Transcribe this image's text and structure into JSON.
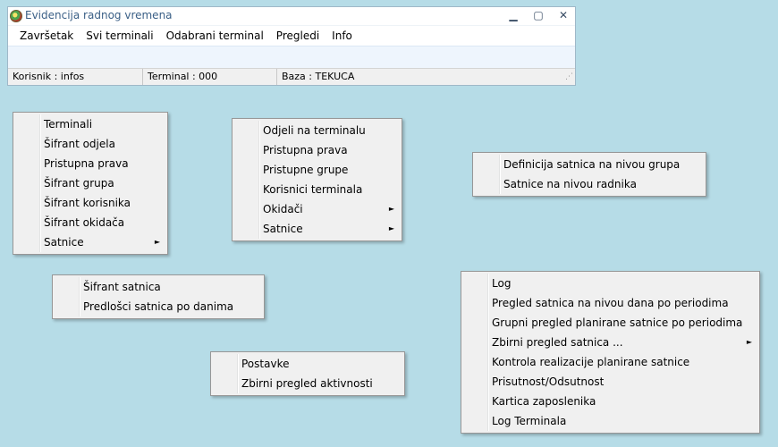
{
  "window": {
    "title": "Evidencija radnog vremena",
    "controls": {
      "minimize": "▁",
      "maximize": "▢",
      "close": "✕"
    },
    "menu": [
      "Završetak",
      "Svi terminali",
      "Odabrani terminal",
      "Pregledi",
      "Info"
    ],
    "status": {
      "user": "Korisnik : infos",
      "terminal": "Terminal : 000",
      "base": "Baza : TEKUCA"
    }
  },
  "menus": {
    "svi_terminali": {
      "items": [
        {
          "label": "Terminali"
        },
        {
          "label": "Šifrant odjela"
        },
        {
          "label": "Pristupna prava"
        },
        {
          "label": "Šifrant grupa"
        },
        {
          "label": "Šifrant korisnika"
        },
        {
          "label": "Šifrant okidača"
        },
        {
          "label": "Satnice",
          "arrow": "►"
        }
      ]
    },
    "odabrani_terminal": {
      "items": [
        {
          "label": "Odjeli na terminalu"
        },
        {
          "label": "Pristupna prava"
        },
        {
          "label": "Pristupne grupe"
        },
        {
          "label": "Korisnici terminala"
        },
        {
          "label": "Okidači",
          "arrow": "►"
        },
        {
          "label": "Satnice",
          "arrow": "►"
        }
      ]
    },
    "satnice_sub": {
      "items": [
        {
          "label": "Definicija satnica na nivou grupa"
        },
        {
          "label": "Satnice na nivou radnika"
        }
      ]
    },
    "svi_satnice_sub": {
      "items": [
        {
          "label": "Šifrant satnica"
        },
        {
          "label": "Predlošci satnica po danima"
        }
      ]
    },
    "info": {
      "items": [
        {
          "label": "Postavke"
        },
        {
          "label": "Zbirni pregled aktivnosti"
        }
      ]
    },
    "pregledi": {
      "items": [
        {
          "label": "Log"
        },
        {
          "label": "Pregled satnica na nivou dana po periodima"
        },
        {
          "label": "Grupni pregled planirane satnice po periodima"
        },
        {
          "label": "Zbirni pregled satnica ...",
          "arrow": "►"
        },
        {
          "label": "Kontrola realizacije planirane satnice"
        },
        {
          "label": "Prisutnost/Odsutnost"
        },
        {
          "label": "Kartica zaposlenika"
        },
        {
          "label": "Log Terminala"
        }
      ]
    }
  }
}
